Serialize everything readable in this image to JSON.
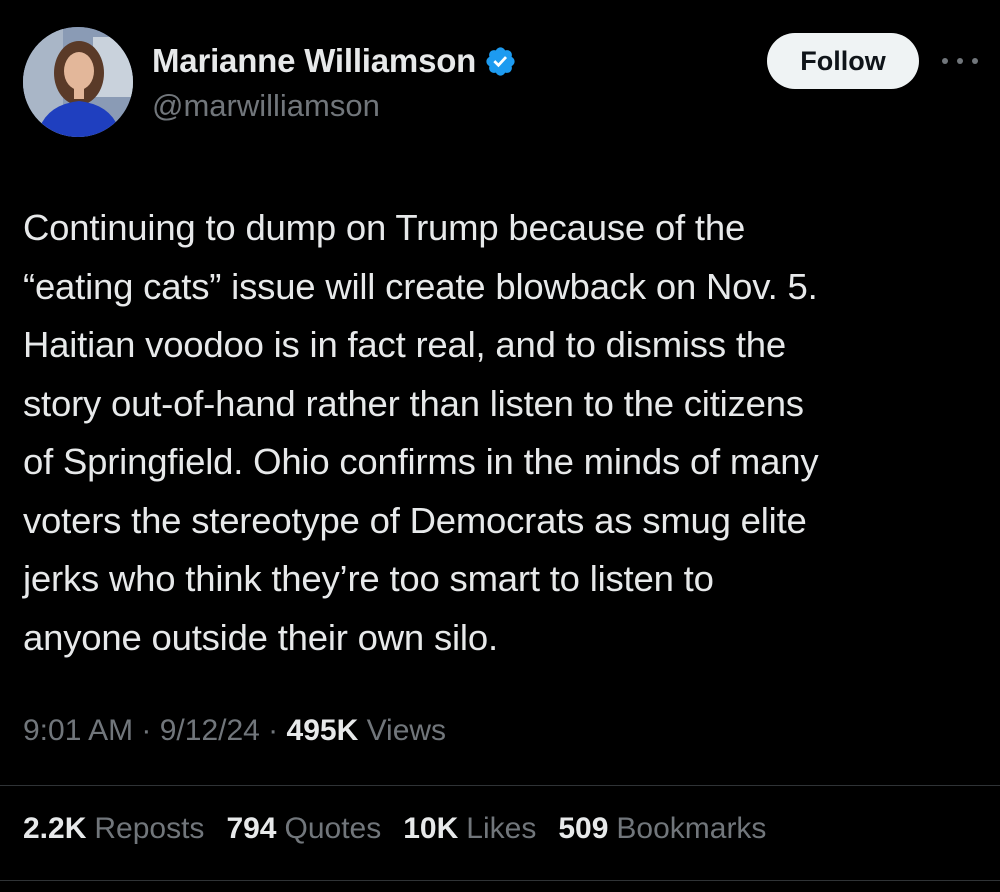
{
  "author": {
    "name": "Marianne Williamson",
    "handle": "@marwilliamson",
    "verified_color": "#1d9bf0"
  },
  "header": {
    "follow_label": "Follow",
    "more_icon": "more-horizontal-icon"
  },
  "tweet": {
    "text": "Continuing to dump on Trump because of the\n“eating cats” issue will create blowback on Nov. 5.\nHaitian voodoo is in fact real, and to dismiss the\nstory out-of-hand rather than listen to the citizens\nof Springfield. Ohio confirms in the minds of many\nvoters the stereotype of Democrats as smug elite\njerks who think they’re too smart to listen to\nanyone outside their own silo."
  },
  "meta": {
    "time": "9:01 AM",
    "sep1": " · ",
    "date": "9/12/24",
    "sep2": " · ",
    "views_count": "495K",
    "views_label": " Views"
  },
  "stats": {
    "reposts_count": "2.2K",
    "reposts_label": "Reposts",
    "quotes_count": "794",
    "quotes_label": "Quotes",
    "likes_count": "10K",
    "likes_label": "Likes",
    "bookmarks_count": "509",
    "bookmarks_label": "Bookmarks"
  }
}
